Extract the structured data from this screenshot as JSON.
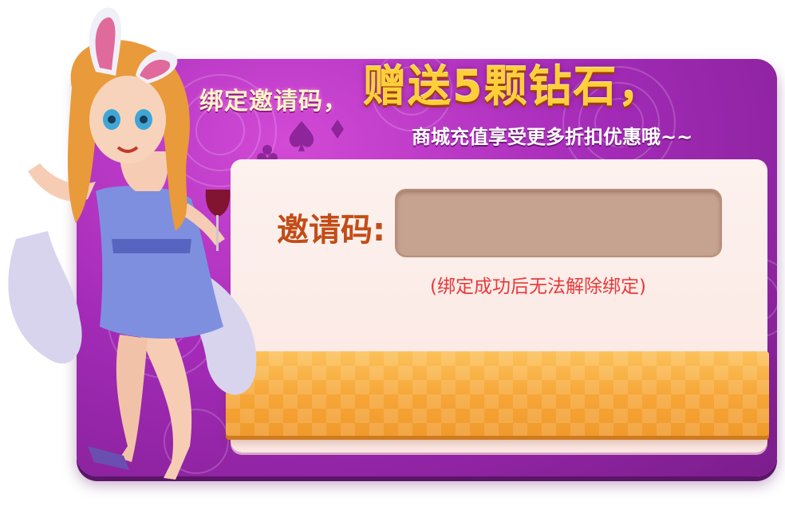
{
  "promo": {
    "title_small": "绑定邀请码，",
    "title_big": "赠送5颗钻石，",
    "subtitle": "商城充值享受更多折扣优惠哦~~"
  },
  "form": {
    "label": "邀请码:",
    "input_value": "",
    "notice": "(绑定成功后无法解除绑定)",
    "confirm_label": ""
  },
  "colors": {
    "panel": "#a42bb8",
    "title_gold": "#ffcf3a",
    "label_orange": "#c24d17",
    "notice_red": "#e8393a",
    "button_orange": "#f5a93c",
    "input_fill": "#c6a290"
  },
  "icons": [
    "spade-icon",
    "diamond-icon",
    "club-icon"
  ]
}
